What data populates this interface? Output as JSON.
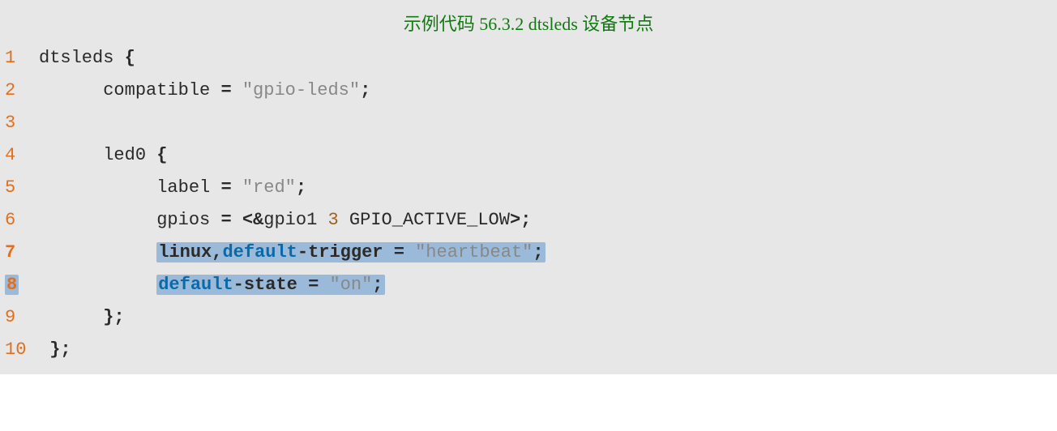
{
  "title": "示例代码 56.3.2 dtsleds 设备节点",
  "lines": {
    "l1": {
      "no": "1",
      "t0": "dtsleds ",
      "br": "{"
    },
    "l2": {
      "no": "2",
      "pad": "      ",
      "id": "compatible ",
      "eq": "= ",
      "str": "\"gpio-leds\"",
      "semi": ";"
    },
    "l3": {
      "no": "3"
    },
    "l4": {
      "no": "4",
      "pad": "      ",
      "id": "led0 ",
      "br": "{"
    },
    "l5": {
      "no": "5",
      "pad": "           ",
      "id": "label ",
      "eq": "= ",
      "str": "\"red\"",
      "semi": ";"
    },
    "l6": {
      "no": "6",
      "pad": "           ",
      "id": "gpios ",
      "eq": "= ",
      "lt": "<&",
      "ref": "gpio1 ",
      "num": "3",
      "sp": " ",
      "macro": "GPIO_ACTIVE_LOW",
      "gt": ">;"
    },
    "l7": {
      "no": "7",
      "pad": "           ",
      "a": "linux",
      "b": ",",
      "c": "default",
      "d": "-",
      "e": "trigger ",
      "eq": "= ",
      "str": "\"heartbeat\"",
      "semi": ";"
    },
    "l8": {
      "no": "8",
      "pad": "           ",
      "a": "default",
      "b": "-",
      "c": "state ",
      "eq": "= ",
      "str": "\"on\"",
      "semi": ";"
    },
    "l9": {
      "no": "9",
      "pad": "      ",
      "br": "};"
    },
    "l10": {
      "no": "10",
      "pad": " ",
      "br": "};"
    }
  }
}
